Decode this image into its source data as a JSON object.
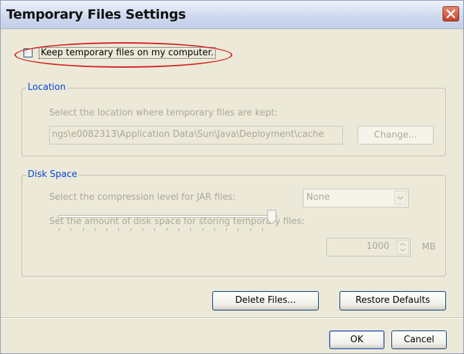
{
  "window": {
    "title": "Temporary Files Settings"
  },
  "keep_files": {
    "label": "Keep temporary files on my computer.",
    "checked": false
  },
  "location": {
    "legend": "Location",
    "description": "Select the location where temporary files are kept:",
    "path_value": "ngs\\e0082313\\Application Data\\Sun\\Java\\Deployment\\cache",
    "change_label": "Change..."
  },
  "disk_space": {
    "legend": "Disk Space",
    "compression_label": "Select the compression level for JAR files:",
    "compression_value": "None",
    "amount_label": "Set the amount of disk space for storing temporary files:",
    "amount_value": "1000",
    "unit": "MB",
    "slider_level": 1.0
  },
  "actions": {
    "delete_label": "Delete Files...",
    "restore_label": "Restore Defaults",
    "ok_label": "OK",
    "cancel_label": "Cancel"
  },
  "colors": {
    "legend": "#0046d5",
    "disabled_text": "#aca899",
    "highlight_ellipse": "#d52121",
    "dialog_bg": "#ece9d8"
  }
}
